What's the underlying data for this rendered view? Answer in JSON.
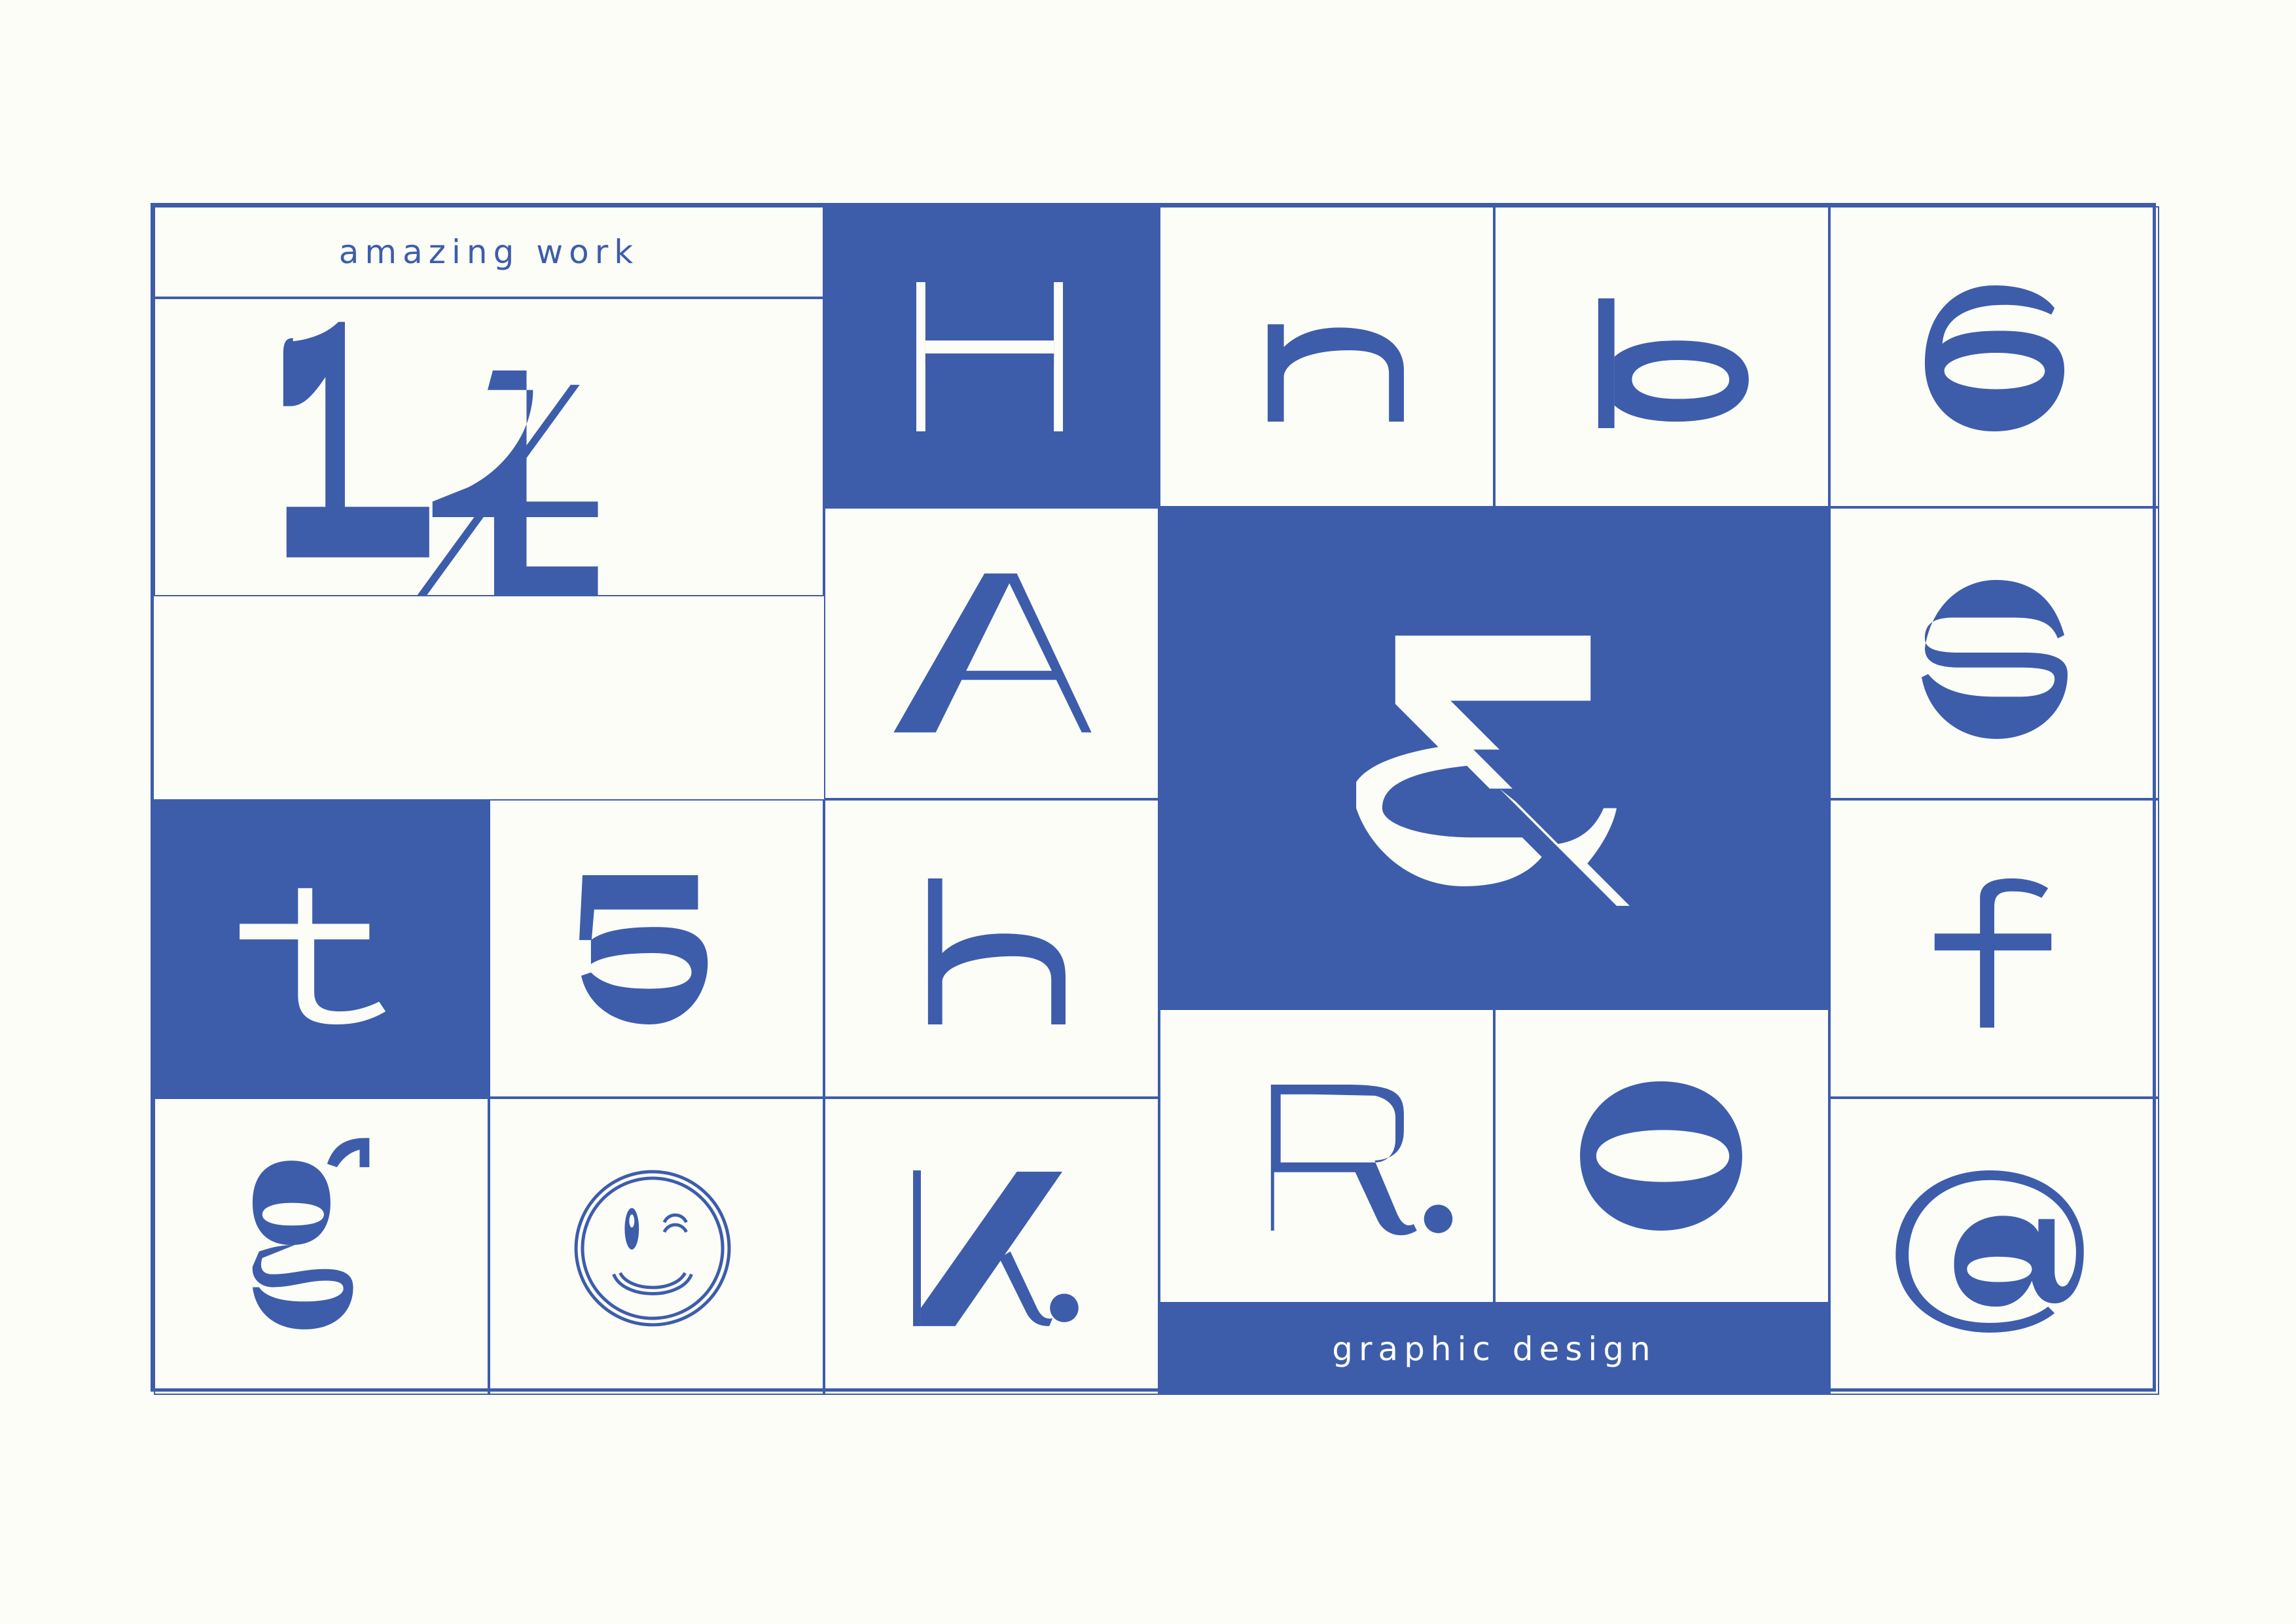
{
  "colors": {
    "brand_blue": "#3d5dab",
    "paper": "#fdfdf8"
  },
  "labels": {
    "top": "amazing work",
    "bottom": "graphic design"
  },
  "glyphs": {
    "fraction": "1/4",
    "capital_h": "H",
    "lower_n": "n",
    "lower_b": "b",
    "numeral_6": "6",
    "capital_a": "A",
    "ampersand": "&",
    "lower_s": "s",
    "lower_t": "t",
    "numeral_5": "5",
    "lower_h": "h",
    "lower_f": "f",
    "lower_g": "g",
    "lower_k": "k.",
    "capital_r": "R.",
    "capital_o": "O",
    "at_sign": "@"
  },
  "icons": {
    "winking_face": "smiley-wink-icon"
  }
}
